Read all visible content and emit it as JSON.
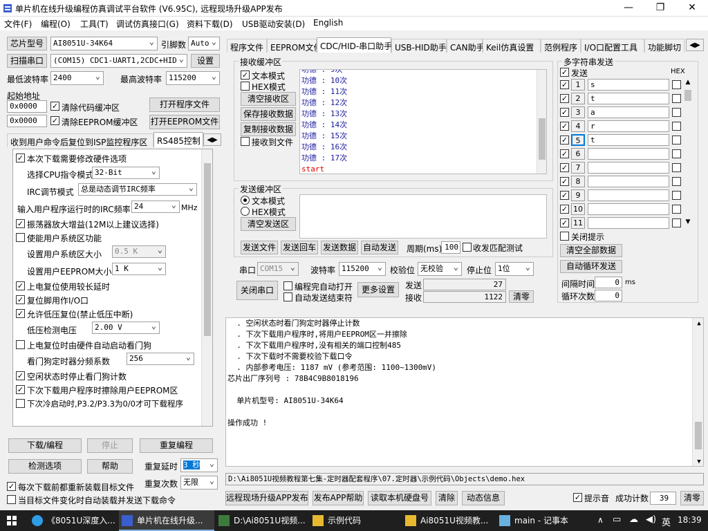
{
  "window": {
    "title": "单片机在线升级编程仿真调试平台软件 (V6.95C), 远程现场升级APP发布"
  },
  "menu": [
    "文件(F)",
    "编程(O)",
    "工具(T)",
    "调试仿真接口(G)",
    "资料下载(D)",
    "USB驱动安装(D)",
    "English"
  ],
  "left": {
    "chip_btn": "芯片型号",
    "chip_value": "AI8051U-34K64",
    "pins_label": "引脚数",
    "pins_value": "Auto",
    "scan_btn": "扫描串口",
    "port_value": "(COM15) CDC1-UART1,2CDC+HID",
    "settings_btn": "设置",
    "min_baud_label": "最低波特率",
    "min_baud": "2400",
    "max_baud_label": "最高波特率",
    "max_baud": "115200",
    "start_addr_label": "起始地址",
    "addr1": "0x0000",
    "clear_code": "清除代码缓冲区",
    "open_prog": "打开程序文件",
    "addr2": "0x0000",
    "clear_eeprom": "清除EEPROM缓冲区",
    "open_eeprom": "打开EEPROM文件",
    "tabs": [
      "收到用户命令后复位到ISP监控程序区",
      "RS485控制"
    ],
    "options": {
      "hw_opt": "本次下载需要修改硬件选项",
      "cpu_label": "选择CPU指令模式",
      "cpu_value": "32-Bit",
      "irc_label": "IRC调节模式",
      "irc_value": "总是动态调节IRC频率",
      "freq_label": "输入用户程序运行时的IRC频率",
      "freq_value": "24",
      "freq_unit": "MHz",
      "osc": "振荡器放大增益(12M以上建议选择)",
      "sysarea": "使能用户系统区功能",
      "sys_size_label": "设置用户系统区大小",
      "sys_size": "0.5 K",
      "eep_size_label": "设置用户EEPROM大小",
      "eep_size": "1   K",
      "pwr_delay": "上电复位使用较长延时",
      "rst_io": "复位脚用作I/O口",
      "lvr": "允许低压复位(禁止低压中断)",
      "lvd_label": "低压检测电压",
      "lvd_value": "2.00 V",
      "wdt_hw": "上电复位时由硬件自动启动看门狗",
      "wdt_div_label": "看门狗定时器分频系数",
      "wdt_div": "256",
      "wdt_idle": "空闲状态时停止看门狗计数",
      "erase_eep": "下次下载用户程序时擦除用户EEPROM区",
      "cold_boot": "下次冷启动时,P3.2/P3.3为0/0才可下载程序"
    },
    "download_btn": "下载/编程",
    "stop_btn": "停止",
    "reprog_btn": "重复编程",
    "check_btn": "检测选项",
    "help_btn": "帮助",
    "delay_label": "重复延时",
    "delay_value": "3 秒",
    "repeat_label": "重复次数",
    "repeat_value": "无限",
    "reload": "每次下载前都重新装载目标文件",
    "autoload": "当目标文件变化时自动装载并发送下载命令"
  },
  "right_tabs": [
    "程序文件",
    "EEPROM文件",
    "CDC/HID-串口助手",
    "USB-HID助手",
    "CAN助手",
    "Keil仿真设置",
    "范例程序",
    "I/O口配置工具",
    "功能脚切"
  ],
  "recv": {
    "title": "接收缓冲区",
    "text_mode": "文本模式",
    "hex_mode": "HEX模式",
    "clear": "清空接收区",
    "save": "保存接收数据",
    "copy": "复制接收数据",
    "to_file": "接收到文件",
    "lines": [
      "功德  : 9次",
      "功德  : 10次",
      "功德  : 11次",
      "功德  : 12次",
      "功德  : 13次",
      "功德  : 14次",
      "功德  : 15次",
      "功德  : 16次",
      "功德  : 17次"
    ],
    "last": "start"
  },
  "send": {
    "title": "发送缓冲区",
    "text_mode": "文本模式",
    "hex_mode": "HEX模式",
    "clear": "清空发送区",
    "send_file": "发送文件",
    "send_cr": "发送回车",
    "send_data": "发送数据",
    "auto_send": "自动发送",
    "period_label": "周期(ms)",
    "period": "100",
    "match": "收发匹配测试"
  },
  "serial": {
    "port_label": "串口",
    "port": "COM15",
    "baud_label": "波特率",
    "baud": "115200",
    "parity_label": "校验位",
    "parity": "无校验",
    "stop_label": "停止位",
    "stop": "1位",
    "close_btn": "关闭串口",
    "auto_open": "编程完自动打开",
    "auto_end": "自动发送结束符",
    "more": "更多设置",
    "sent_label": "发送",
    "sent": "27",
    "recv_label": "接收",
    "recv": "1122",
    "clear_btn": "清零"
  },
  "multi": {
    "title": "多字符串发送",
    "send_hdr": "发送",
    "hex_hdr": "HEX",
    "rows": [
      "s",
      "t",
      "a",
      "r",
      "t",
      "",
      "",
      "",
      "",
      "",
      ""
    ],
    "close_hint": "关闭提示",
    "clear_all": "清空全部数据",
    "auto_loop": "自动循环发送",
    "interval_label": "间隔时间",
    "interval": "0",
    "interval_unit": "ms",
    "loop_label": "循环次数",
    "loop": "0"
  },
  "log": [
    "  . 空闲状态时看门狗定时器停止计数",
    "  . 下次下载用户程序时,将用户EEPROM区一并擦除",
    "  . 下次下载用户程序时,没有相关的端口控制485",
    "  . 下次下载时不需要校验下载口令",
    "  . 内部参考电压: 1187 mV (参考范围: 1100~1300mV)",
    "芯片出厂序列号 : 78B4C9B8018196",
    "",
    "  单片机型号: AI8051U-34K64",
    "",
    "操作成功 !"
  ],
  "path": "D:\\Ai8051U视频教程第七集-定时器配套程序\\07.定时器\\示例代码\\Objects\\demo.hex",
  "bottom": {
    "remote_btn": "远程现场升级APP发布",
    "publish_help": "发布APP帮助",
    "read_disk": "读取本机硬盘号",
    "clear_btn": "清除",
    "dynamic": "动态信息",
    "sound": "提示音",
    "success_label": "成功计数",
    "success": "39",
    "reset_btn": "清零"
  },
  "taskbar": {
    "items": [
      "《8051U深度入...",
      "单片机在线升级...",
      "D:\\Ai8051U视频...",
      "示例代码",
      "Ai8051U视频教...",
      "main - 记事本"
    ],
    "lang": "英",
    "time": "18:39"
  }
}
